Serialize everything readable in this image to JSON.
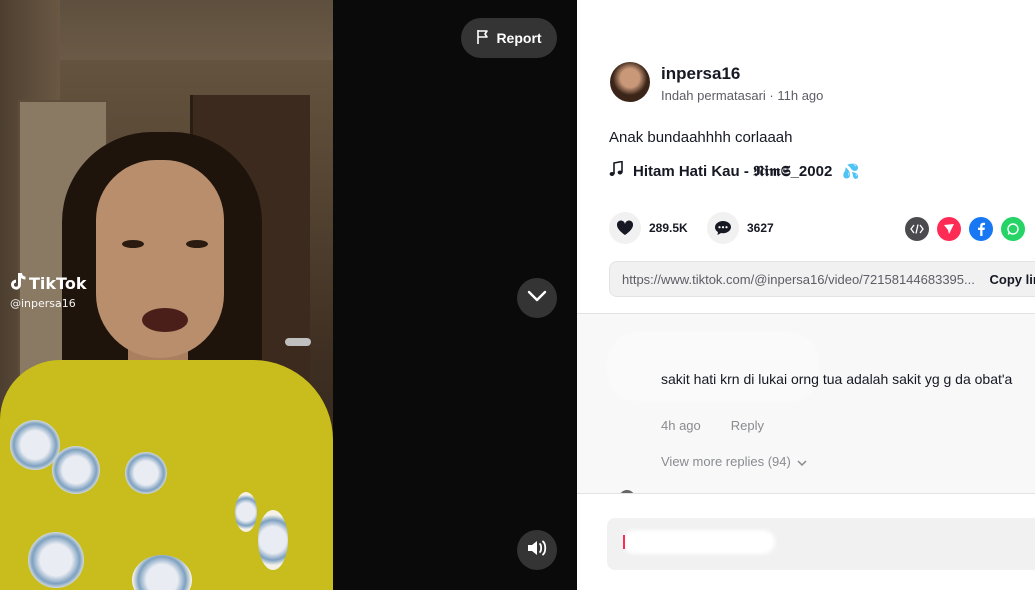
{
  "video": {
    "watermark_brand": "TikTok",
    "watermark_user": "@inpersa16",
    "report_label": "Report",
    "next_icon": "chevron-down-icon",
    "volume_icon": "speaker-icon"
  },
  "author": {
    "username": "inpersa16",
    "display_name": "Indah permatasari",
    "time_ago": "11h ago"
  },
  "post": {
    "caption": "Anak bundaahhhh corlaaah",
    "music_title": "Hitam Hati Kau - 𝕹𝖎𝖒𝕾_2002",
    "music_emoji": "💦"
  },
  "stats": {
    "likes": "289.5K",
    "comments": "3627"
  },
  "share": {
    "icons": [
      "embed-icon",
      "send-icon",
      "facebook-icon",
      "whatsapp-icon"
    ],
    "link": "https://www.tiktok.com/@inpersa16/video/72158144683395...",
    "copy_label": "Copy link"
  },
  "comment": {
    "text": "sakit hati krn di lukai orng tua adalah sakit yg g da obat'a",
    "time_ago": "4h ago",
    "reply_label": "Reply",
    "more_replies": "View more replies (94)"
  },
  "colors": {
    "accent": "#fe2c55",
    "text_primary": "#161823",
    "text_secondary": "#5c5d65",
    "facebook": "#1877f2",
    "whatsapp": "#25d366",
    "send": "#fe2c55",
    "embed": "#4a4a4f"
  }
}
